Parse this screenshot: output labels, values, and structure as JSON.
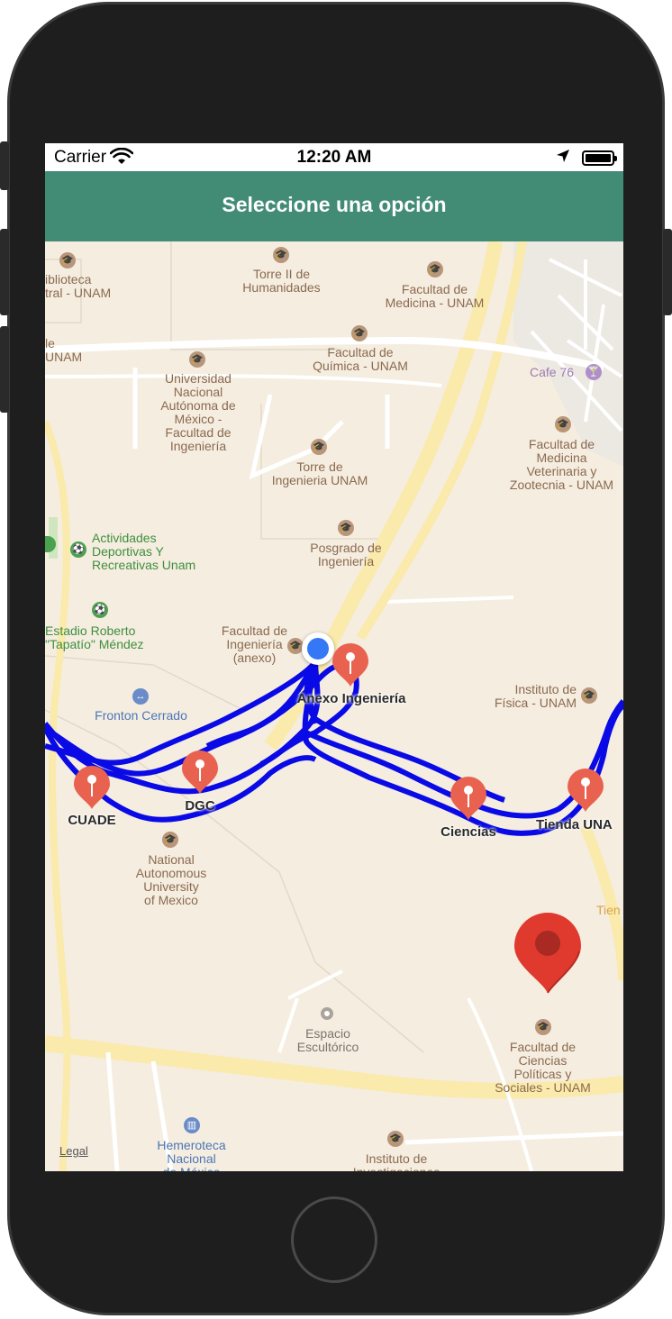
{
  "status_bar": {
    "carrier": "Carrier",
    "time": "12:20 AM"
  },
  "nav_bar": {
    "title": "Seleccione una opción"
  },
  "map": {
    "legal": "Legal",
    "route_color": "#0a0ae6",
    "pin_color": "#e8624f",
    "large_marker_color": "#e03a2f",
    "user_location_color": "#3478f6",
    "stop_pins": [
      {
        "label": "Anexo Ingeniería"
      },
      {
        "label": "CUADE"
      },
      {
        "label": "DGC"
      },
      {
        "label": "Ciencias"
      },
      {
        "label": "Tienda UNA"
      }
    ],
    "places": [
      {
        "name": "iblioteca\ntral - UNAM",
        "icon": "graduation-cap-icon"
      },
      {
        "name": "Torre II de\nHumanidades",
        "icon": "graduation-cap-icon"
      },
      {
        "name": "Facultad de\nMedicina - UNAM",
        "icon": "graduation-cap-icon"
      },
      {
        "name": "le\nUNAM",
        "icon": "graduation-cap-icon"
      },
      {
        "name": "Facultad de\nQuímica - UNAM",
        "icon": "graduation-cap-icon"
      },
      {
        "name": "Cafe 76",
        "icon": "cocktail-icon"
      },
      {
        "name": "Universidad\nNacional\nAutónoma de\nMéxico -\nFacultad de\nIngeniería",
        "icon": "graduation-cap-icon"
      },
      {
        "name": "Torre de\nIngenieria UNAM",
        "icon": "graduation-cap-icon"
      },
      {
        "name": "Facultad de\nMedicina\nVeterinaria y\nZootecnia - UNAM",
        "icon": "graduation-cap-icon"
      },
      {
        "name": "Actividades\nDeportivas Y\nRecreativas Unam",
        "icon": "stadium-icon"
      },
      {
        "name": "Posgrado de\nIngeniería",
        "icon": "graduation-cap-icon"
      },
      {
        "name": "Estadio Roberto\n\"Tapatío\" Méndez",
        "icon": "stadium-icon"
      },
      {
        "name": "Facultad de\nIngeniería\n(anexo)",
        "icon": "graduation-cap-icon"
      },
      {
        "name": "Fronton Cerrado",
        "icon": "sports-icon"
      },
      {
        "name": "Instituto de\nFísica - UNAM",
        "icon": "graduation-cap-icon"
      },
      {
        "name": "National\nAutonomous\nUniversity\nof Mexico",
        "icon": "graduation-cap-icon"
      },
      {
        "name": "Tien",
        "icon": ""
      },
      {
        "name": "Espacio\nEscultórico",
        "icon": "landmark-icon"
      },
      {
        "name": "Facultad de\nCiencias\nPolíticas y\nSociales - UNAM",
        "icon": "graduation-cap-icon"
      },
      {
        "name": "Hemeroteca\nNacional\nde México",
        "icon": "book-icon"
      },
      {
        "name": "Instituto de\nInvestigaciones",
        "icon": "graduation-cap-icon"
      }
    ]
  }
}
